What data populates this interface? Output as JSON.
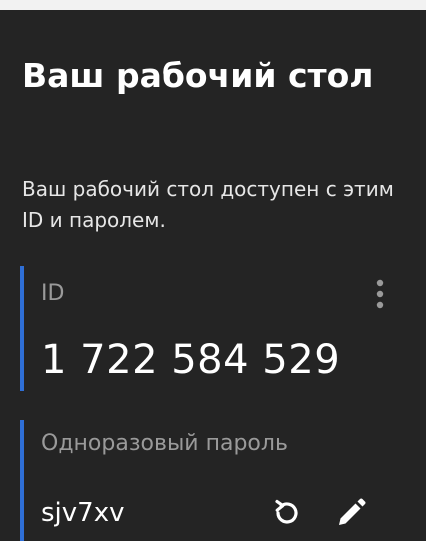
{
  "panel": {
    "title": "Ваш рабочий стол",
    "subtitle": "Ваш рабочий стол доступен с этим ID и паролем."
  },
  "id_field": {
    "label": "ID",
    "value": "1 722 584 529",
    "more_icon": "more-vertical-icon"
  },
  "otp_field": {
    "label": "Одноразовый пароль",
    "value": "sjv7xv",
    "refresh_icon": "refresh-icon",
    "edit_icon": "pencil-icon"
  },
  "colors": {
    "background": "#242424",
    "accent": "#2f6fd6",
    "text": "#ffffff",
    "muted": "#9a9a9a"
  }
}
